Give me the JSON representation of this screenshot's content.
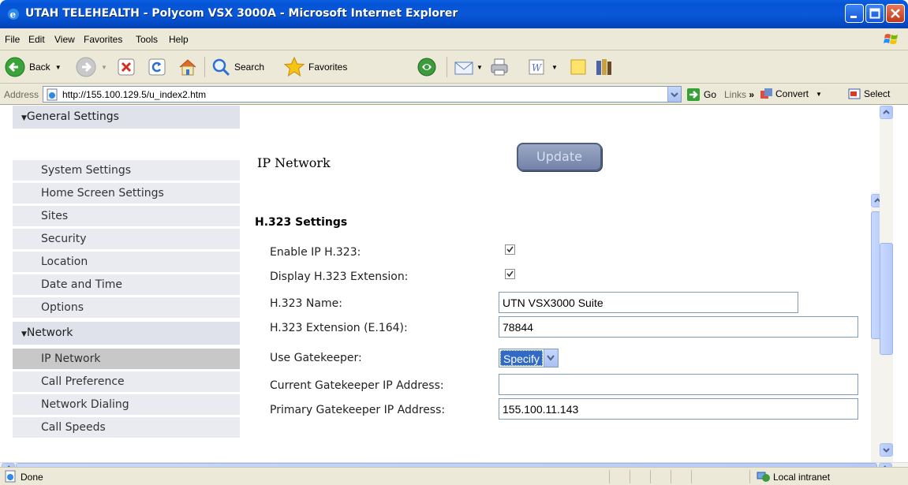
{
  "window": {
    "title": "UTAH TELEHEALTH - Polycom VSX 3000A - Microsoft Internet Explorer"
  },
  "menubar": {
    "items": [
      "File",
      "Edit",
      "View",
      "Favorites",
      "Tools",
      "Help"
    ]
  },
  "toolbar": {
    "back_label": "Back",
    "search_label": "Search",
    "favorites_label": "Favorites"
  },
  "addressbar": {
    "label": "Address",
    "url": "http://155.100.129.5/u_index2.htm",
    "go_label": "Go",
    "links_label": "Links",
    "convert_label": "Convert",
    "select_label": "Select"
  },
  "sidebar": {
    "general": {
      "header": "General Settings",
      "items": [
        "System Settings",
        "Home Screen Settings",
        "Sites",
        "Security",
        "Location",
        "Date and Time",
        "Options"
      ]
    },
    "network": {
      "header": "Network",
      "items": [
        "IP Network",
        "Call Preference",
        "Network Dialing",
        "Call Speeds"
      ],
      "active": "IP Network"
    }
  },
  "main": {
    "heading": "IP Network",
    "update_label": "Update",
    "section_title": "H.323 Settings",
    "fields": {
      "enable_ip_h323": {
        "label": "Enable IP H.323:",
        "checked": true
      },
      "display_ext": {
        "label": "Display H.323 Extension:",
        "checked": true
      },
      "h323_name": {
        "label": "H.323 Name:",
        "value": "UTN VSX3000 Suite"
      },
      "h323_ext": {
        "label": "H.323 Extension (E.164):",
        "value": "78844"
      },
      "use_gatekeeper": {
        "label": "Use Gatekeeper:",
        "value": "Specify"
      },
      "current_gk": {
        "label": "Current Gatekeeper IP Address:",
        "value": ""
      },
      "primary_gk": {
        "label": "Primary Gatekeeper IP Address:",
        "value": "155.100.11.143"
      }
    }
  },
  "statusbar": {
    "status": "Done",
    "zone": "Local intranet"
  }
}
